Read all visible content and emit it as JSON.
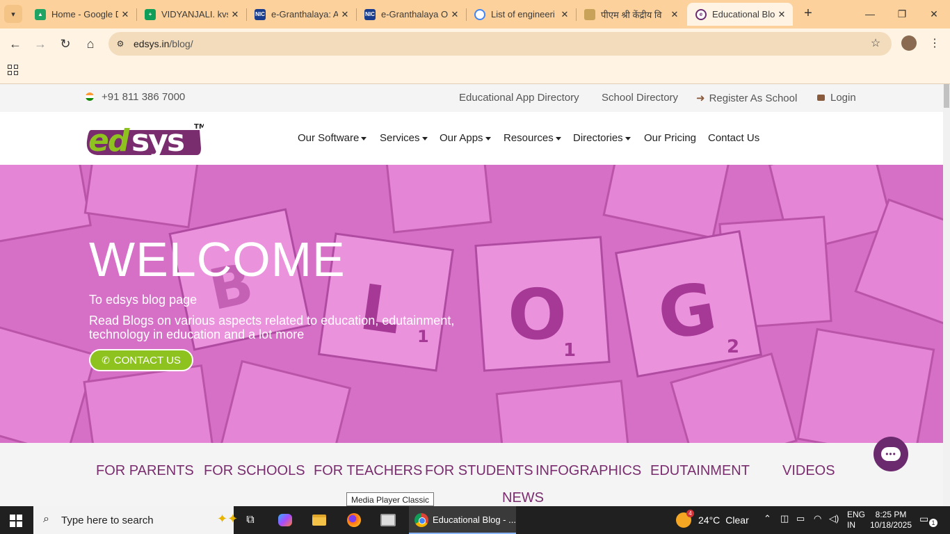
{
  "browser": {
    "tabs": [
      {
        "title": "Home - Google Drive",
        "favicon": "google-drive-icon",
        "color": "#1fa463"
      },
      {
        "title": "VIDYANJALI. kvs",
        "favicon": "sheets-icon",
        "color": "#0f9d58"
      },
      {
        "title": "e-Granthalaya: A",
        "favicon": "nic-icon",
        "color": "#1a3c8c"
      },
      {
        "title": "e-Granthalaya O",
        "favicon": "nic-icon",
        "color": "#1a3c8c"
      },
      {
        "title": "List of engineeri",
        "favicon": "google-icon",
        "color": "#4285f4"
      },
      {
        "title": "पीएम श्री केंद्रीय वि",
        "favicon": "emblem-icon",
        "color": "#c9a25a"
      },
      {
        "title": "Educational Blog",
        "favicon": "edsys-icon",
        "color": "#6b2a6d",
        "active": true
      }
    ],
    "address": {
      "domain": "edsys.in",
      "path": "/blog/"
    }
  },
  "site": {
    "topbar": {
      "phone": "+91 811 386 7000",
      "links": [
        "Educational App Directory",
        "School Directory",
        "Register As School",
        "Login"
      ]
    },
    "logo": {
      "text": "edsys",
      "tm": "TM"
    },
    "nav": [
      "Our Software",
      "Services",
      "Our Apps",
      "Resources",
      "Directories",
      "Our Pricing",
      "Contact Us"
    ],
    "hero": {
      "title": "WELCOME",
      "subtitle": "To edsys blog page",
      "description": "Read Blogs on various aspects related to education, edutainment, technology in education and a lot more",
      "cta": "CONTACT US"
    },
    "categories": [
      "FOR PARENTS",
      "FOR SCHOOLS",
      "FOR TEACHERS",
      "FOR STUDENTS",
      "INFOGRAPHICS",
      "EDUTAINMENT",
      "VIDEOS",
      "NEWS"
    ],
    "tooltip": "Media Player Classic"
  },
  "taskbar": {
    "search_placeholder": "Type here to search",
    "active_app": "Educational Blog - ...",
    "weather": {
      "temp": "24°C",
      "condition": "Clear",
      "badge": "4"
    },
    "lang": [
      "ENG",
      "IN"
    ],
    "time": "8:25 PM",
    "date": "10/18/2025",
    "notifications": "1"
  },
  "colors": {
    "brand_purple": "#7a2d6e",
    "brand_green": "#8dc21f",
    "hero_pink": "#d66fc6",
    "tab_bg": "#fdd19b"
  }
}
